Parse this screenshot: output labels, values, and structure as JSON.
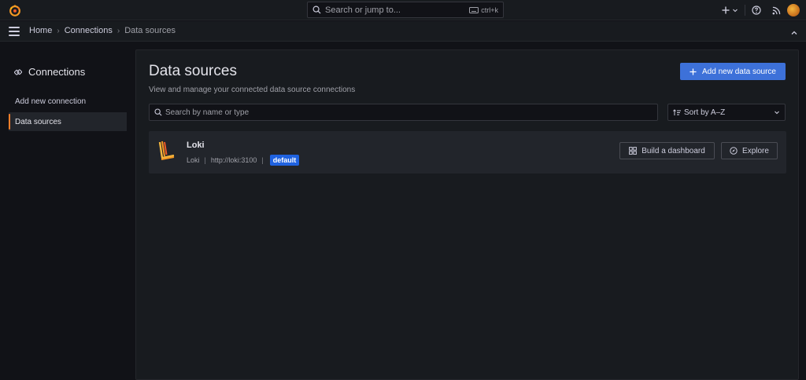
{
  "topbar": {
    "search_placeholder": "Search or jump to...",
    "shortcut": "ctrl+k"
  },
  "breadcrumb": {
    "items": [
      "Home",
      "Connections",
      "Data sources"
    ]
  },
  "sidebar": {
    "title": "Connections",
    "items": [
      {
        "label": "Add new connection",
        "active": false
      },
      {
        "label": "Data sources",
        "active": true
      }
    ]
  },
  "main": {
    "title": "Data sources",
    "subtitle": "View and manage your connected data source connections",
    "add_button": "Add new data source",
    "search_placeholder": "Search by name or type",
    "sort_label": "Sort by A–Z",
    "datasources": [
      {
        "name": "Loki",
        "type": "Loki",
        "url": "http://loki:3100",
        "badge": "default",
        "build_button": "Build a dashboard",
        "explore_button": "Explore"
      }
    ]
  },
  "colors": {
    "accent": "#3d71d9",
    "active_indicator": "#ff7f2a",
    "badge": "#1f62e0",
    "background": "#111217",
    "panel": "#181b1f"
  }
}
